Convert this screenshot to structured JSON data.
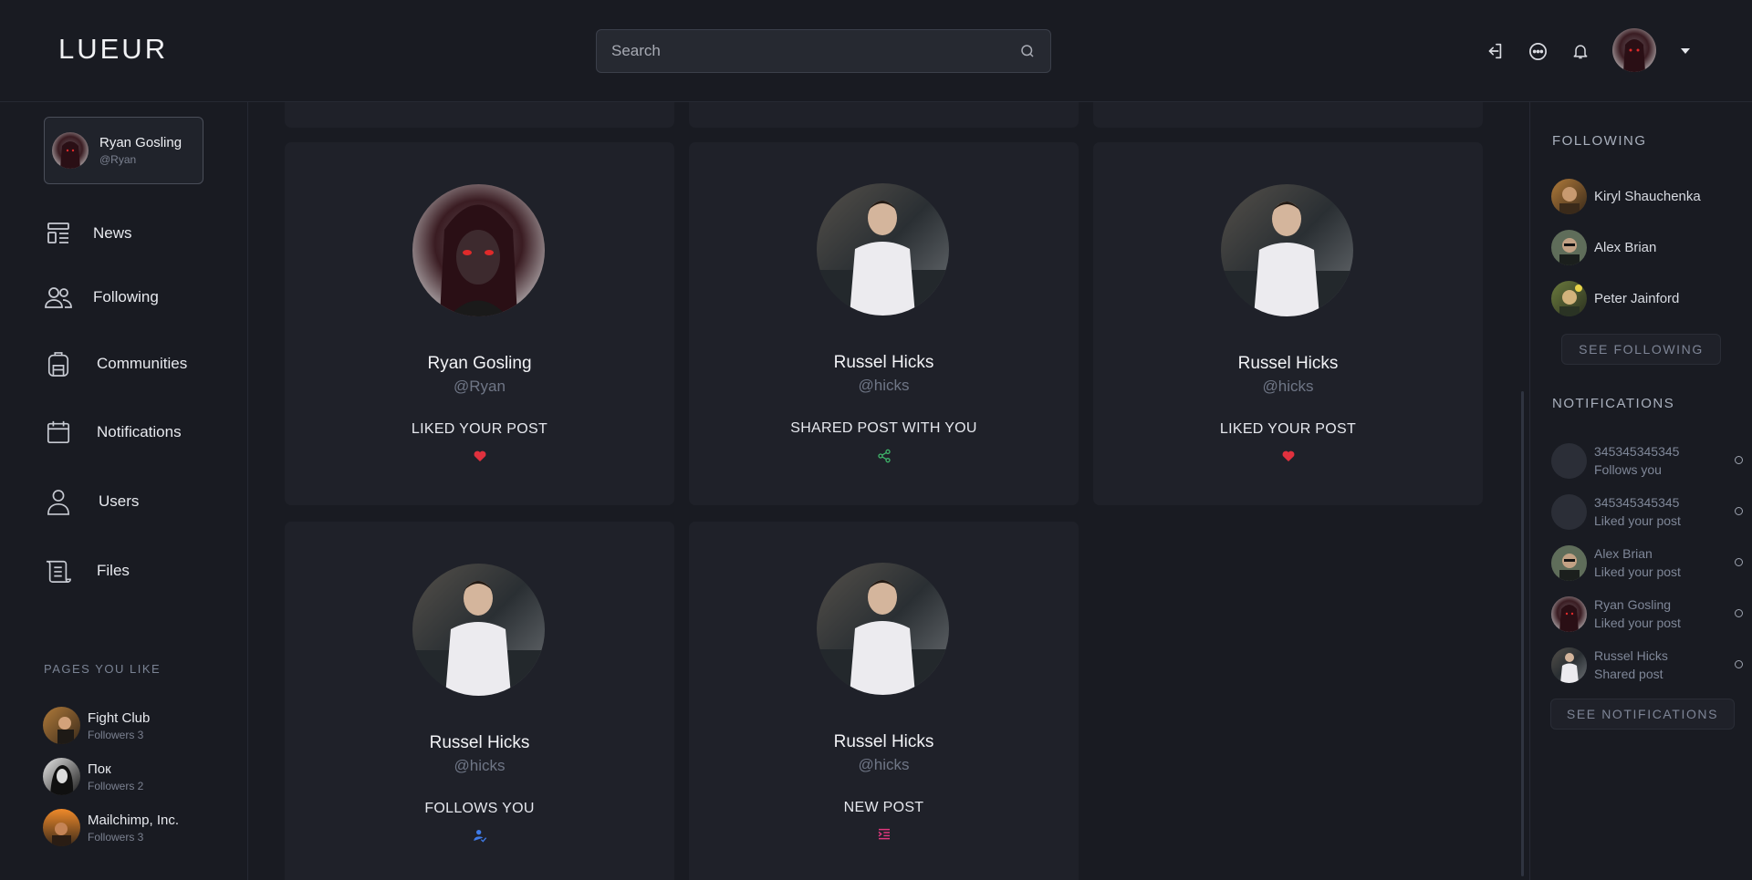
{
  "header": {
    "logo": "LUEUR",
    "search_placeholder": "Search",
    "icons": [
      "logout-icon",
      "chat-icon",
      "bell-icon"
    ]
  },
  "profile": {
    "name": "Ryan Gosling",
    "handle": "@Ryan"
  },
  "nav": [
    {
      "label": "News",
      "icon": "news-icon"
    },
    {
      "label": "Following",
      "icon": "users-icon"
    },
    {
      "label": "Communities",
      "icon": "backpack-icon"
    },
    {
      "label": "Notifications",
      "icon": "calendar-icon"
    },
    {
      "label": "Users",
      "icon": "user-icon"
    },
    {
      "label": "Files",
      "icon": "scroll-icon"
    }
  ],
  "pages_title": "PAGES YOU LIKE",
  "pages": [
    {
      "name": "Fight Club",
      "followers": "Followers 3"
    },
    {
      "name": "Пок",
      "followers": "Followers 2"
    },
    {
      "name": "Mailchimp, Inc.",
      "followers": "Followers 3"
    }
  ],
  "cards": [
    {
      "name": "Ryan Gosling",
      "handle": "@Ryan",
      "action": "LIKED YOUR POST",
      "icon": "heart-icon",
      "icon_color": "#e0313e"
    },
    {
      "name": "Russel Hicks",
      "handle": "@hicks",
      "action": "SHARED POST WITH YOU",
      "icon": "share-icon",
      "icon_color": "#3fb56a"
    },
    {
      "name": "Russel Hicks",
      "handle": "@hicks",
      "action": "LIKED YOUR POST",
      "icon": "heart-icon",
      "icon_color": "#e0313e"
    },
    {
      "name": "Russel Hicks",
      "handle": "@hicks",
      "action": "FOLLOWS YOU",
      "icon": "user-check-icon",
      "icon_color": "#3f7be8"
    },
    {
      "name": "Russel Hicks",
      "handle": "@hicks",
      "action": "NEW POST",
      "icon": "indent-icon",
      "icon_color": "#e0377d"
    }
  ],
  "following_title": "FOLLOWING",
  "following": [
    {
      "name": "Kiryl Shauchenka"
    },
    {
      "name": "Alex Brian"
    },
    {
      "name": "Peter Jainford"
    }
  ],
  "see_following": "SEE FOLLOWING",
  "notifications_title": "NOTIFICATIONS",
  "notifications": [
    {
      "name": "345345345345",
      "text": "Follows you"
    },
    {
      "name": "345345345345",
      "text": "Liked your post"
    },
    {
      "name": "Alex Brian",
      "text": "Liked your post"
    },
    {
      "name": "Ryan Gosling",
      "text": "Liked your post"
    },
    {
      "name": "Russel Hicks",
      "text": "Shared post"
    }
  ],
  "see_notifications": "SEE NOTIFICATIONS"
}
